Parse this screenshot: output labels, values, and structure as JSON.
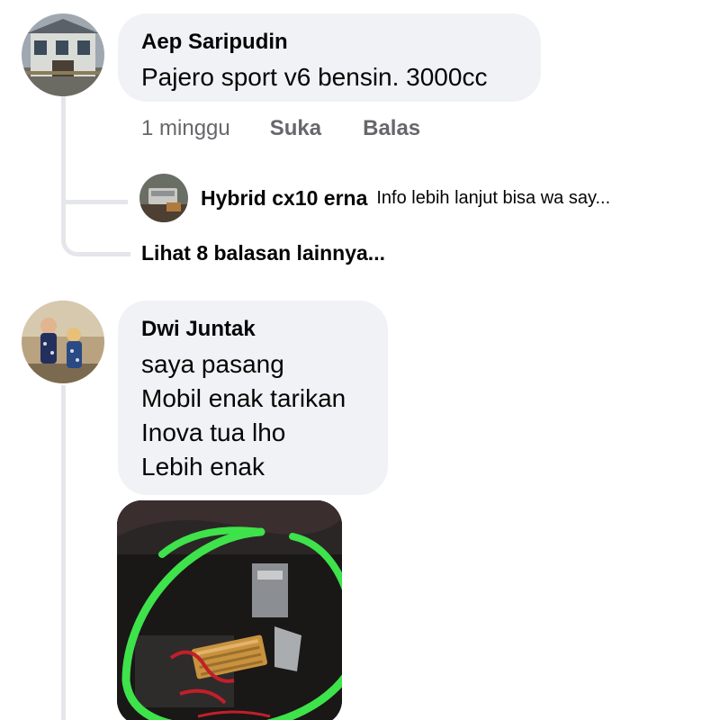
{
  "comments": [
    {
      "author": "Aep Saripudin",
      "text_lines": [
        "Pajero sport v6 bensin. 3000cc"
      ],
      "time": "1 minggu",
      "like_label": "Suka",
      "reply_label": "Balas",
      "reply_preview": {
        "author": "Hybrid cx10 erna",
        "snippet": "Info lebih lanjut bisa wa say..."
      },
      "more_replies_label": "Lihat 8 balasan lainnya..."
    },
    {
      "author": "Dwi Juntak",
      "text_lines": [
        "saya pasang",
        "Mobil enak tarikan",
        "Inova tua lho",
        "Lebih enak"
      ]
    }
  ],
  "colors": {
    "bubble": "#f0f2f5",
    "meta_text": "#65676b",
    "highlight_circle": "#3ee24a",
    "device_gold": "#c8923e"
  },
  "icons": [
    "avatar-house",
    "avatar-children",
    "avatar-device"
  ]
}
